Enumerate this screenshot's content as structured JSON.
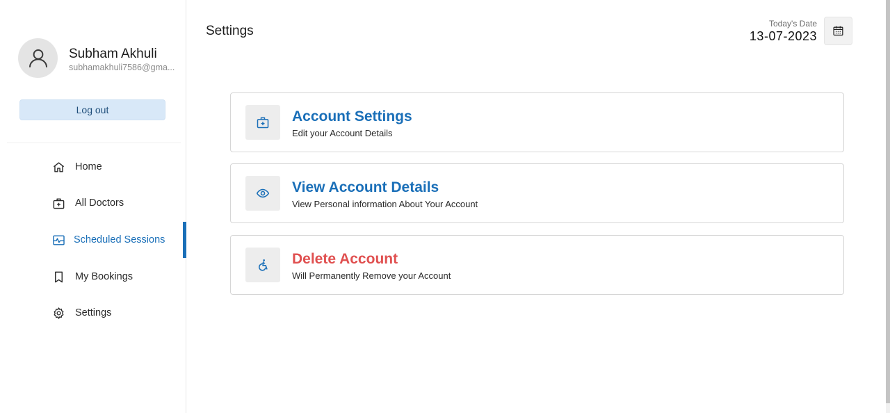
{
  "profile": {
    "name": "Subham Akhuli",
    "email": "subhamakhuli7586@gma..."
  },
  "logout_label": "Log out",
  "nav": {
    "items": [
      {
        "label": "Home",
        "icon": "home-icon"
      },
      {
        "label": "All Doctors",
        "icon": "doctor-bag-icon"
      },
      {
        "label": "Scheduled Sessions",
        "icon": "schedule-icon",
        "active": true
      },
      {
        "label": "My Bookings",
        "icon": "bookmark-icon"
      },
      {
        "label": "Settings",
        "icon": "gear-icon"
      }
    ]
  },
  "header": {
    "title": "Settings",
    "date_label": "Today's Date",
    "date_value": "13-07-2023"
  },
  "cards": [
    {
      "title": "Account Settings",
      "description": "Edit your Account Details",
      "icon": "doctor-bag-icon"
    },
    {
      "title": "View Account Details",
      "description": "View Personal information About Your Account",
      "icon": "eye-icon"
    },
    {
      "title": "Delete Account",
      "description": "Will Permanently Remove your Account",
      "icon": "accessible-icon"
    }
  ],
  "colors": {
    "accent": "#1a6fb8",
    "danger": "#e05050",
    "logout_bg": "#d8e8f8"
  }
}
